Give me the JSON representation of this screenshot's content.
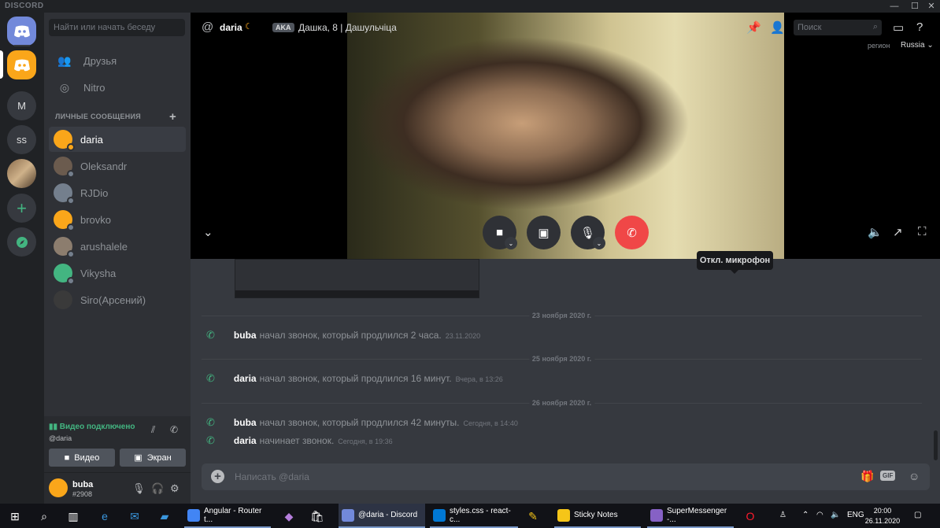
{
  "window": {
    "brand": "DISCORD",
    "controls": [
      "—",
      "☐",
      "✕"
    ]
  },
  "guilds": [
    {
      "name": "home",
      "label": ""
    },
    {
      "name": "active",
      "label": ""
    },
    {
      "name": "m",
      "label": "M"
    },
    {
      "name": "ss",
      "label": "ss"
    },
    {
      "name": "photo",
      "label": ""
    },
    {
      "name": "add",
      "label": "+"
    },
    {
      "name": "explore",
      "label": "➤"
    }
  ],
  "sidebar": {
    "search_placeholder": "Найти или начать беседу",
    "friends": "Друзья",
    "nitro": "Nitro",
    "dm_header": "ЛИЧНЫЕ СООБЩЕНИЯ",
    "dm_add": "+",
    "dms": [
      {
        "name": "daria",
        "color": "#faa61a",
        "status": "#faa61a",
        "selected": true
      },
      {
        "name": "Oleksandr",
        "color": "#6b5b4e",
        "status": "#747f8d"
      },
      {
        "name": "RJDio",
        "color": "#747f8d",
        "status": "#747f8d"
      },
      {
        "name": "brovko",
        "color": "#faa61a",
        "status": "#747f8d"
      },
      {
        "name": "arushalele",
        "color": "#8c7d6e",
        "status": "#747f8d"
      },
      {
        "name": "Vikysha",
        "color": "#43b581",
        "status": "#747f8d"
      },
      {
        "name": "Siro(Арсений)",
        "color": "#3a3a3a",
        "status": ""
      }
    ]
  },
  "voice": {
    "title": "Видео подключено",
    "channel": "@daria",
    "video_label": "Видео",
    "screen_label": "Экран"
  },
  "user": {
    "name": "buba",
    "tag": "#2908"
  },
  "call": {
    "at": "@",
    "name": "daria",
    "moon": "☾",
    "aka": "AKA",
    "nick": "Дашка, 8 | Дашульчіца",
    "search_placeholder": "Поиск",
    "region_label": "регион",
    "region_value": "Russia ⌄",
    "tooltip": "Откл. микрофон"
  },
  "messages": [
    {
      "divider": "23 ноября 2020 г.",
      "user": "buba",
      "text": "начал звонок, который продлился 2 часа.",
      "time": "23.11.2020"
    },
    {
      "divider": "25 ноября 2020 г.",
      "user": "daria",
      "text": "начал звонок, который продлился 16 минут.",
      "time": "Вчера, в 13:26"
    },
    {
      "divider": "26 ноября 2020 г.",
      "user": "buba",
      "text": "начал звонок, который продлился 42 минуты.",
      "time": "Сегодня, в 14:40"
    },
    {
      "divider": "",
      "user": "daria",
      "text": "начинает звонок.",
      "time": "Сегодня, в 19:36"
    }
  ],
  "composer": {
    "placeholder": "Написать @daria",
    "gif": "GIF"
  },
  "taskbar": {
    "apps": [
      {
        "label": "Angular - Router t...",
        "color": "#4285f4"
      },
      {
        "label": "@daria - Discord",
        "color": "#7289da"
      },
      {
        "label": "styles.css - react-c...",
        "color": "#0078d4"
      },
      {
        "label": "Sticky Notes",
        "color": "#f5c518"
      },
      {
        "label": "SuperMessenger -...",
        "color": "#8661c5"
      }
    ],
    "lang": "ENG",
    "time": "20:00",
    "date": "26.11.2020"
  }
}
